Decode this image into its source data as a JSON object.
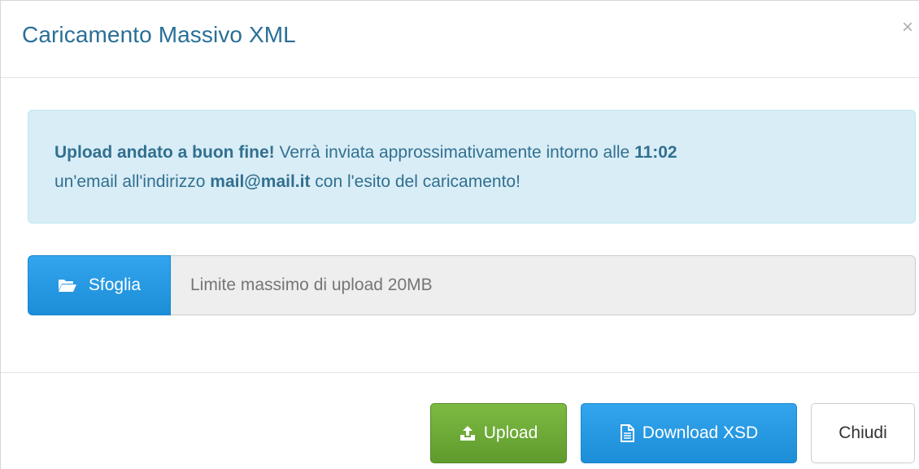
{
  "modal": {
    "title": "Caricamento Massivo XML",
    "close_glyph": "×"
  },
  "alert": {
    "strong_intro": "Upload andato a buon fine!",
    "text_1": " Verrà inviata approssimativamente intorno alle ",
    "time": "11:02",
    "text_2": "un'email all'indirizzo ",
    "email": "mail@mail.it",
    "text_3": " con l'esito del caricamento!"
  },
  "file_upload": {
    "browse_label": "Sfoglia",
    "browse_icon": "folder-open-icon",
    "placeholder": "Limite massimo di upload 20MB"
  },
  "footer": {
    "upload_label": "Upload",
    "upload_icon": "upload-icon",
    "download_label": "Download XSD",
    "download_icon": "file-icon",
    "close_label": "Chiudi"
  },
  "colors": {
    "title": "#2a6f97",
    "alert_bg": "#d9edf7",
    "alert_text": "#31708f",
    "primary": "#1c8ed8",
    "success": "#5e9b2d"
  }
}
